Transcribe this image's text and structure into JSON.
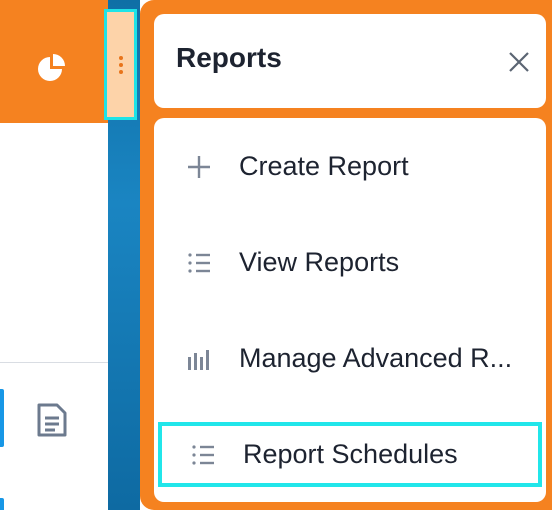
{
  "panel": {
    "title": "Reports",
    "items": [
      {
        "label": "Create Report",
        "icon": "plus-icon"
      },
      {
        "label": "View Reports",
        "icon": "list-icon"
      },
      {
        "label": "Manage Advanced R...",
        "icon": "bar-chart-icon"
      },
      {
        "label": "Report Schedules",
        "icon": "list-icon"
      }
    ]
  },
  "colors": {
    "accent": "#f58220",
    "highlight": "#1ee3e7",
    "strip": "#1a85c2"
  }
}
